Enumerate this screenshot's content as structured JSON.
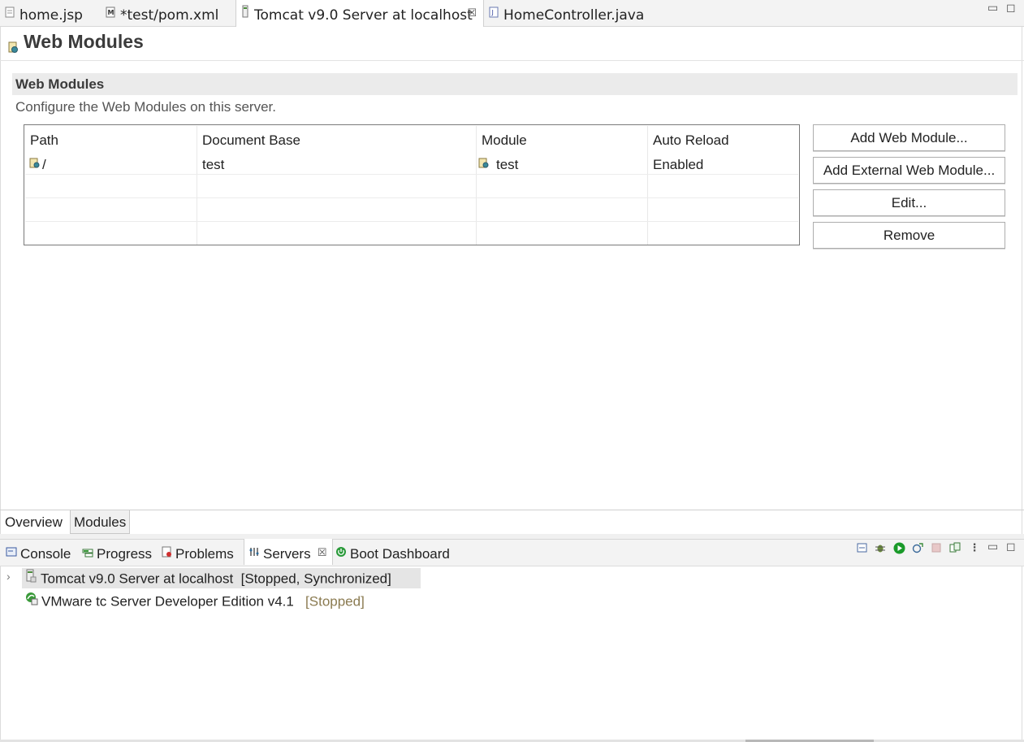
{
  "editor_tabs": [
    {
      "label": "home.jsp",
      "icon": "jsp-file-icon"
    },
    {
      "label": "*test/pom.xml",
      "icon": "maven-pom-icon"
    },
    {
      "label": "Tomcat v9.0 Server at localhost",
      "icon": "server-icon",
      "active": true
    },
    {
      "label": "HomeController.java",
      "icon": "java-file-icon"
    }
  ],
  "page": {
    "title": "Web Modules"
  },
  "section": {
    "title": "Web Modules",
    "description": "Configure the Web Modules on this server."
  },
  "table": {
    "columns": [
      "Path",
      "Document Base",
      "Module",
      "Auto Reload"
    ],
    "rows": [
      {
        "path": "/",
        "document_base": "test",
        "module": "test",
        "auto_reload": "Enabled"
      }
    ]
  },
  "buttons": {
    "add_web_module": "Add Web Module...",
    "add_external": "Add External Web Module...",
    "edit": "Edit...",
    "remove": "Remove"
  },
  "page_tabs": [
    "Overview",
    "Modules"
  ],
  "view_tabs": [
    {
      "label": "Console",
      "icon": "console-icon"
    },
    {
      "label": "Progress",
      "icon": "progress-icon"
    },
    {
      "label": "Problems",
      "icon": "problems-icon"
    },
    {
      "label": "Servers",
      "icon": "servers-icon",
      "active": true
    },
    {
      "label": "Boot Dashboard",
      "icon": "boot-dashboard-icon"
    }
  ],
  "servers": [
    {
      "name": "Tomcat v9.0 Server at localhost",
      "status": "[Stopped, Synchronized]"
    },
    {
      "name": "VMware tc Server Developer Edition v4.1",
      "status": "[Stopped]"
    }
  ],
  "colors": {
    "status_stopped": "#8a7a50",
    "start_green": "#1a9a2a",
    "boot_green": "#2a9a3a"
  }
}
